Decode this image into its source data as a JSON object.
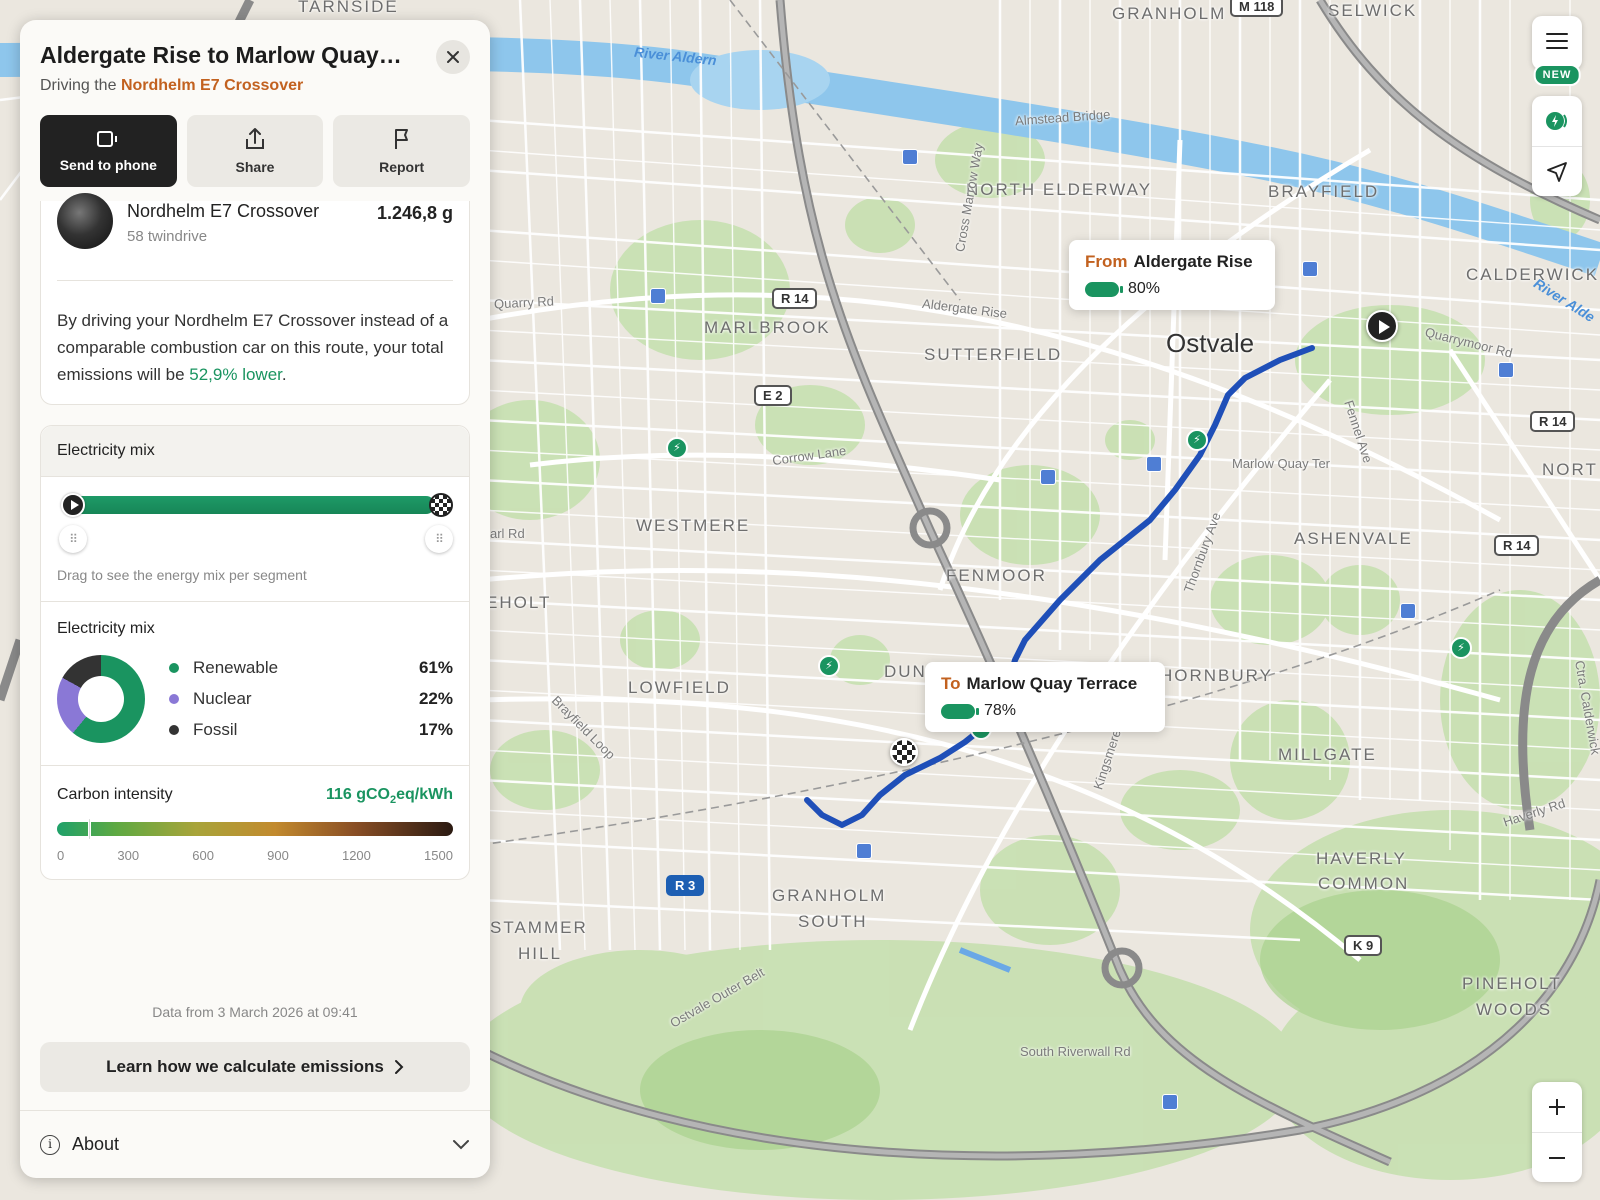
{
  "panel": {
    "title": "Aldergate Rise to Marlow Quay…",
    "subtitle_prefix": "Driving the",
    "subtitle_vehicle": "Nordhelm E7 Crossover",
    "actions": [
      {
        "label": "Send to phone",
        "icon": "phone-send-icon"
      },
      {
        "label": "Share",
        "icon": "share-icon"
      },
      {
        "label": "Report",
        "icon": "flag-icon"
      }
    ],
    "vehicle": {
      "name": "Nordhelm E7 Crossover",
      "type": "58 twindrive",
      "value": "1.246,8 g"
    },
    "emissions": {
      "text_prefix": "By driving your Nordhelm E7 Crossover instead of a comparable combustion car on this route, your total emissions will be ",
      "highlight": "52,9% lower",
      "text_suffix": "."
    },
    "mix_header": "Electricity mix",
    "slider_hint": "Drag to see the energy mix per segment",
    "mix_title": "Electricity mix",
    "mix_items": [
      {
        "label": "Renewable",
        "value": "61%",
        "color": "#1a9460",
        "percent": 61
      },
      {
        "label": "Nuclear",
        "value": "22%",
        "color": "#8a78d6",
        "percent": 22
      },
      {
        "label": "Fossil",
        "value": "17%",
        "color": "#333333",
        "percent": 17
      }
    ],
    "carbon": {
      "label": "Carbon intensity",
      "value_prefix": "116 gCO",
      "value_sub": "2",
      "value_suffix": "eq/kWh",
      "value": 116,
      "max": 1500,
      "ticks": [
        "0",
        "300",
        "600",
        "900",
        "1200",
        "1500"
      ]
    },
    "data_from": "Data from 3 March 2026 at 09:41",
    "learn_label": "Learn how we calculate emissions",
    "about_label": "About"
  },
  "map": {
    "city": "Ostvale",
    "districts": [
      "TARNSIDE",
      "GRANHOLM",
      "SELWICK",
      "NORTH ELDERWAY",
      "BRAYFIELD",
      "CALDERWICK",
      "MARLBROOK",
      "SUTTERFIELD",
      "WESTMERE",
      "FENMOOR",
      "ASHENVALE",
      "NORT",
      "EHOLT",
      "LOWFIELD",
      "DUN",
      "HORNBURY",
      "MILLGATE",
      "HAVERLY",
      "COMMON",
      "GRANHOLM",
      "SOUTH",
      "STAMMER",
      "HILL",
      "PINEHOLT",
      "WOODS"
    ],
    "streets": [
      "Almstead Bridge",
      "Cross Marrow Way",
      "Quarry Rd",
      "Aldergate Rise",
      "Corrow Lane",
      "Marlow Quay Ter",
      "Fennel Ave",
      "Thornbury Ave",
      "Quarrymoor Rd",
      "Haverly Rd",
      "Brayfield Loop",
      "Kingsmere",
      "Ostvale Outer Belt",
      "South Riverwall Rd",
      "Ctra. Calderwick",
      "arl Rd"
    ],
    "rivers": [
      "River Aldern",
      "River Alde"
    ],
    "shields": [
      "M 118",
      "R 14",
      "E 2",
      "R 14",
      "R 14",
      "R 3",
      "K 9"
    ],
    "from_bubble": {
      "dir": "From",
      "name": "Aldergate Rise",
      "battery": "80%",
      "battery_level": 80
    },
    "to_bubble": {
      "dir": "To",
      "name": "Marlow Quay Terrace",
      "battery": "78%",
      "battery_level": 78
    },
    "new_badge": "NEW"
  },
  "colors": {
    "accent_orange": "#c2611f",
    "green": "#1a9460",
    "route_blue": "#1f4fb8"
  }
}
